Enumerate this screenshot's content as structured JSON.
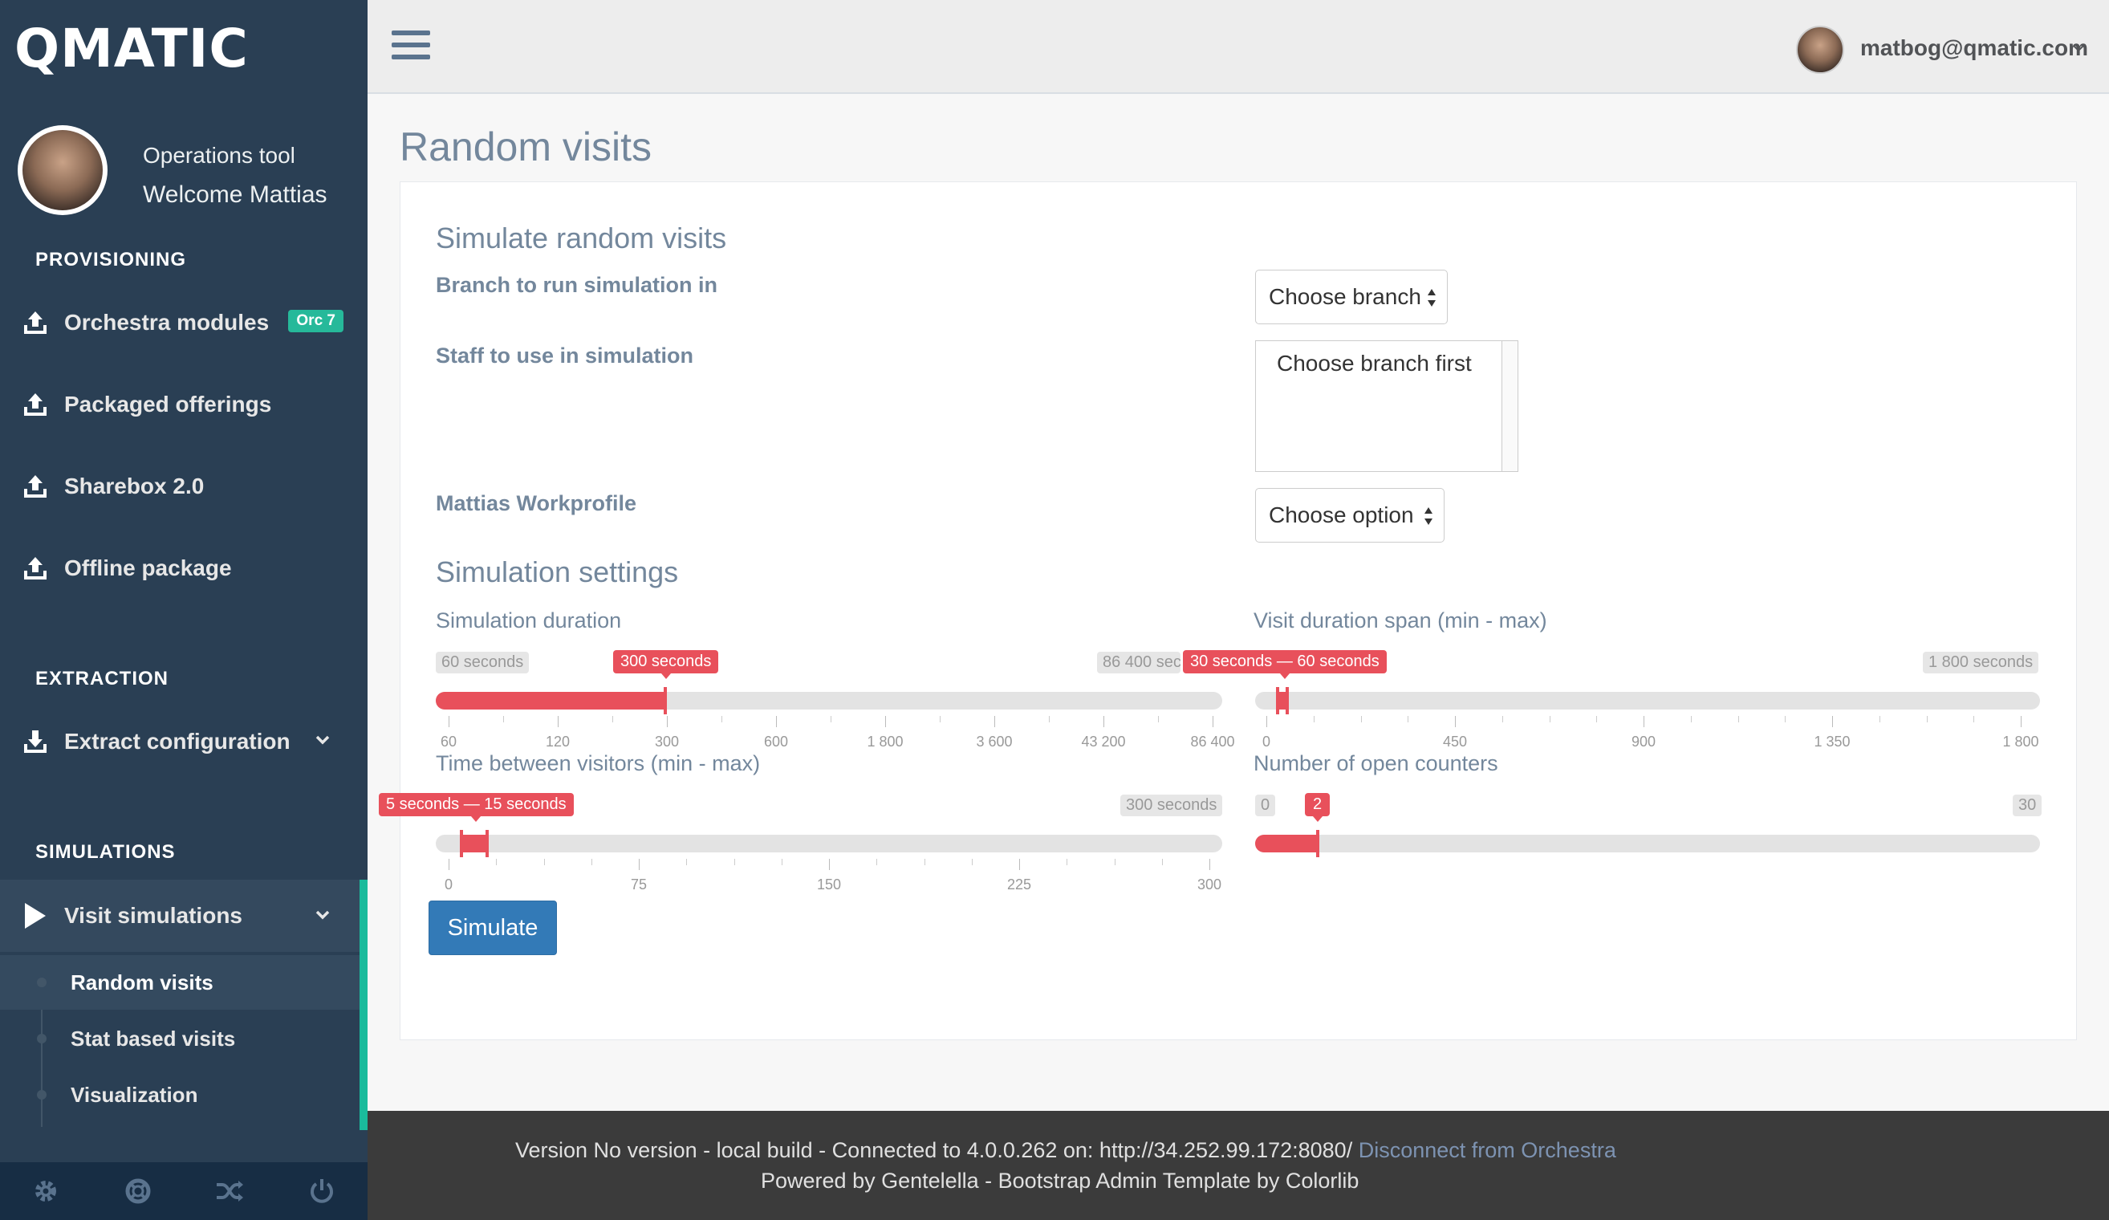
{
  "brand": {
    "logo_text": "QMATIC"
  },
  "profile": {
    "title": "Operations tool",
    "welcome": "Welcome Mattias"
  },
  "sidebar": {
    "sections": [
      {
        "title": "PROVISIONING"
      },
      {
        "title": "EXTRACTION"
      },
      {
        "title": "SIMULATIONS"
      }
    ],
    "items": [
      {
        "label": "Orchestra modules",
        "badge": "Orc 7",
        "icon": "upload-icon"
      },
      {
        "label": "Packaged offerings",
        "icon": "upload-icon"
      },
      {
        "label": "Sharebox 2.0",
        "icon": "upload-icon"
      },
      {
        "label": "Offline package",
        "icon": "upload-icon"
      },
      {
        "label": "Extract configuration",
        "icon": "download-icon"
      },
      {
        "label": "Visit simulations",
        "icon": "play-icon"
      }
    ],
    "sub_items": [
      {
        "label": "Random visits",
        "active": true
      },
      {
        "label": "Stat based visits"
      },
      {
        "label": "Visualization"
      }
    ],
    "footer_icons": [
      "gear-icon",
      "lifebuoy-icon",
      "shuffle-icon",
      "power-icon"
    ],
    "accent_color": "#1abb9c"
  },
  "topbar": {
    "user_email": "matbog@qmatic.com"
  },
  "page": {
    "title": "Random visits"
  },
  "form": {
    "section1_title": "Simulate random visits",
    "branch_label": "Branch to run simulation in",
    "branch_select": "Choose branch",
    "staff_label": "Staff to use in simulation",
    "staff_placeholder": "Choose branch first",
    "workprofile_label": "Mattias Workprofile",
    "workprofile_select": "Choose option",
    "section2_title": "Simulation settings",
    "sliders": {
      "duration": {
        "label": "Simulation duration",
        "min_label": "60 seconds",
        "max_label": "86 400 seconds",
        "value_label": "300 seconds",
        "value": 300,
        "ticks": [
          "60",
          "120",
          "300",
          "600",
          "1 800",
          "3 600",
          "43 200",
          "86 400"
        ]
      },
      "visit_span": {
        "label": "Visit duration span (min - max)",
        "min_label": "",
        "max_label": "1 800 seconds",
        "value_label": "30 seconds — 60 seconds",
        "value_min": 30,
        "value_max": 60,
        "ticks": [
          "0",
          "450",
          "900",
          "1 350",
          "1 800"
        ]
      },
      "between": {
        "label": "Time between visitors (min - max)",
        "min_label": "",
        "max_label": "300 seconds",
        "value_label": "5 seconds — 15 seconds",
        "value_min": 5,
        "value_max": 15,
        "ticks": [
          "0",
          "75",
          "150",
          "225",
          "300"
        ]
      },
      "counters": {
        "label": "Number of open counters",
        "min_label": "0",
        "max_label": "30",
        "value_label": "2",
        "value": 2,
        "ticks": []
      }
    },
    "simulate_button": "Simulate"
  },
  "footer": {
    "line1_text": "Version No version - local build - Connected to 4.0.0.262 on: http://34.252.99.172:8080/",
    "line1_link": "Disconnect from Orchestra",
    "line2": "Powered by Gentelella - Bootstrap Admin Template by Colorlib"
  },
  "colors": {
    "slider_accent": "#e8505b",
    "primary_button": "#337ab7",
    "sidebar_bg": "#2a3f54"
  }
}
